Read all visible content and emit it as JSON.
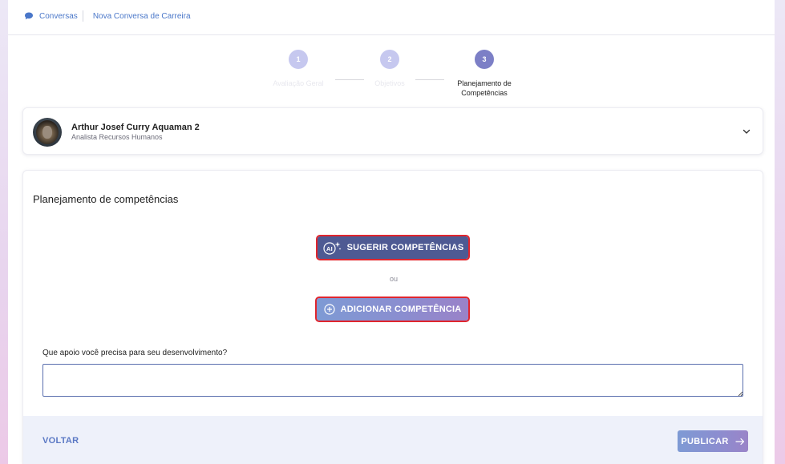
{
  "breadcrumb": {
    "items": [
      {
        "label": "Conversas"
      },
      {
        "label": "Nova Conversa de Carreira"
      }
    ]
  },
  "stepper": {
    "steps": [
      {
        "number": "1",
        "label": "Avaliação Geral",
        "state": "inactive"
      },
      {
        "number": "2",
        "label": "Objetivos",
        "state": "inactive"
      },
      {
        "number": "3",
        "label": "Planejamento de Competências",
        "state": "active"
      }
    ]
  },
  "profile": {
    "name": "Arthur Josef Curry Aquaman 2",
    "role": "Analista Recursos Humanos"
  },
  "main": {
    "title": "Planejamento de competências",
    "suggest_label": "SUGERIR COMPETÊNCIAS",
    "or_label": "ou",
    "add_label": "ADICIONAR COMPETÊNCIA",
    "support_question": "Que apoio você precisa para seu desenvolvimento?",
    "support_value": ""
  },
  "footer": {
    "back_label": "VOLTAR",
    "publish_label": "PUBLICAR"
  },
  "colors": {
    "accent": "#4e5a93",
    "link": "#4a77c9",
    "highlight_border": "#e0262e",
    "step_active": "#7c7fc6",
    "step_inactive": "#c6c8ef"
  }
}
